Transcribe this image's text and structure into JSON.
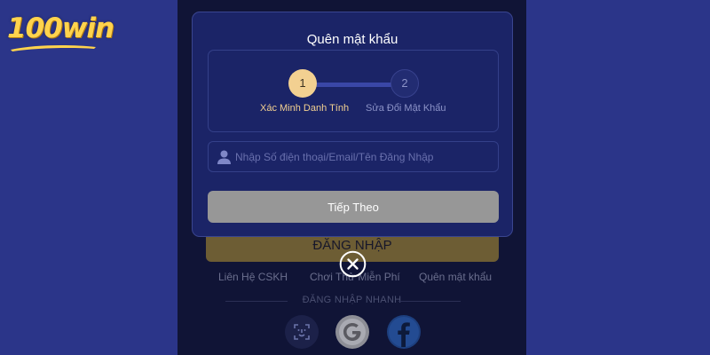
{
  "brand": {
    "logo_text": "100win"
  },
  "modal": {
    "title": "Quên mật khẩu",
    "steps": [
      {
        "number": "1",
        "label": "Xác Minh Danh Tính"
      },
      {
        "number": "2",
        "label": "Sửa Đổi Mật Khẩu"
      }
    ],
    "input": {
      "placeholder": "Nhập Số điện thoại/Email/Tên Đăng Nhập",
      "value": ""
    },
    "next_label": "Tiếp Theo"
  },
  "background": {
    "login_label": "ĐĂNG NHẬP",
    "links": [
      "Liên Hệ CSKH",
      "Chơi Thử Miễn Phí",
      "Quên mật khẩu"
    ],
    "quick_login": "ĐĂNG NHẬP NHANH"
  },
  "colors": {
    "page_bg": "#2b3589",
    "panel_bg": "#101436",
    "modal_bg": "#1b2467",
    "accent_gold": "#f2d091",
    "next_button": "#979797"
  },
  "icons": {
    "close": "close-icon",
    "user": "user-icon",
    "face_id": "face-id-icon",
    "google": "google-icon",
    "facebook": "facebook-icon"
  }
}
